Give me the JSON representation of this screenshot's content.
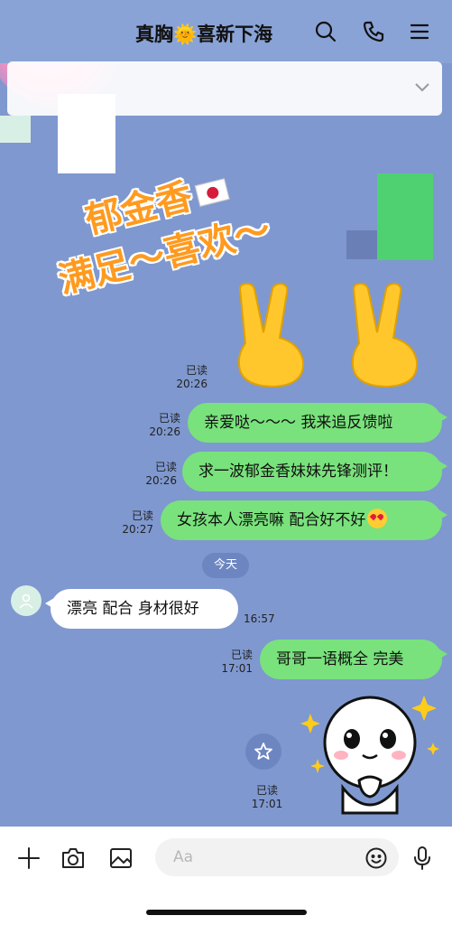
{
  "header": {
    "title": "真胸🌞喜新下海",
    "icons": [
      "search-icon",
      "phone-icon",
      "menu-icon"
    ]
  },
  "overlay": {
    "line1": "郁金香",
    "line2": "满足～喜欢～",
    "text_color": "#ff9a1f"
  },
  "messages": [
    {
      "id": "m0",
      "direction": "out",
      "content": "sticker-victory-hands",
      "read": "已读",
      "time": "20:26"
    },
    {
      "id": "m1",
      "direction": "out",
      "text": "亲爱哒～～～ 我来追反馈啦",
      "read": "已读",
      "time": "20:26"
    },
    {
      "id": "m2",
      "direction": "out",
      "text": "求一波郁金香妹妹先锋测评！",
      "read": "已读",
      "time": "20:26"
    },
    {
      "id": "m3",
      "direction": "out",
      "text": "女孩本人漂亮嘛 配合好不好",
      "emoji": "heart-eyes-emoji",
      "read": "已读",
      "time": "20:27"
    },
    {
      "id": "m4",
      "direction": "in",
      "text": "漂亮 配合 身材很好",
      "time": "16:57"
    },
    {
      "id": "m5",
      "direction": "out",
      "text": "哥哥一语概全 完美",
      "read": "已读",
      "time": "17:01"
    },
    {
      "id": "m6",
      "direction": "out",
      "content": "sticker-pleading-face",
      "read": "已读",
      "time": "17:01"
    }
  ],
  "date_divider": "今天",
  "input_bar": {
    "placeholder": "Aa",
    "tools": [
      "plus-icon",
      "camera-icon",
      "image-icon"
    ],
    "emoji_button": "smiley-icon",
    "mic_button": "mic-icon"
  },
  "colors": {
    "chat_bg": "#7f98cf",
    "outgoing_bubble": "#79e27c",
    "incoming_bubble": "#ffffff"
  }
}
